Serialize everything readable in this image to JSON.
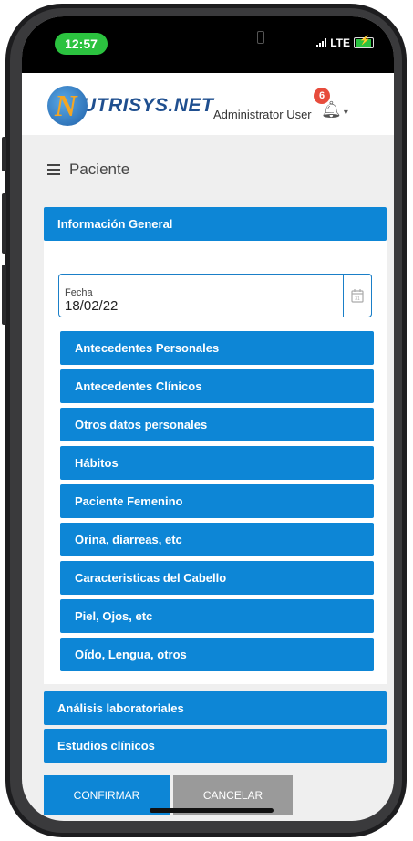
{
  "status_bar": {
    "time": "12:57",
    "network": "LTE"
  },
  "header": {
    "logo_text": "UTRISYS.NET",
    "user_name": "Administrator User",
    "notification_count": "6"
  },
  "page": {
    "title": "Paciente"
  },
  "general_section": {
    "title": "Información General",
    "date_field": {
      "label": "Fecha",
      "value": "18/02/22"
    },
    "buttons": [
      "Antecedentes Personales",
      "Antecedentes Clínicos",
      "Otros datos personales",
      "Hábitos",
      "Paciente Femenino",
      "Orina, diarreas, etc",
      "Caracteristicas del Cabello",
      "Piel, Ojos, etc",
      "Oído, Lengua, otros"
    ]
  },
  "sections": [
    "Análisis laboratoriales",
    "Estudios clínicos"
  ],
  "actions": {
    "confirm": "CONFIRMAR",
    "cancel": "CANCELAR"
  },
  "colors": {
    "primary": "#0d86d6",
    "cancel": "#9a9a9a",
    "status_green": "#2bc23f",
    "badge": "#e74c3c"
  }
}
